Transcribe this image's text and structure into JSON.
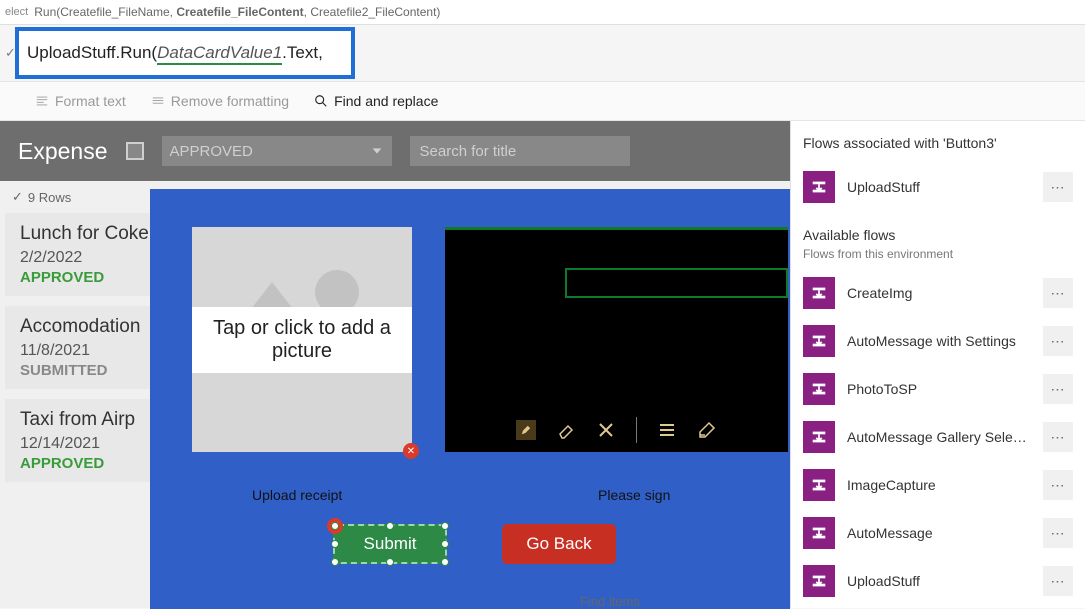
{
  "topHint": {
    "prefix": "Run(Createfile_FileName, ",
    "bold": "Createfile_FileContent",
    "rest": ", Createfile2_FileContent)"
  },
  "formula": {
    "part1": "UploadStuff.Run(",
    "ref": "DataCardValue1",
    "part2": ".Text,"
  },
  "toolbar": {
    "format": "Format text",
    "remove": "Remove formatting",
    "find": "Find and replace"
  },
  "expense": {
    "title": "Expense",
    "ddLabel": "APPROVED",
    "searchPlaceholder": "Search for title",
    "rowCount": "9 Rows"
  },
  "listItems": [
    {
      "title": "Lunch for Coke",
      "date": "2/2/2022",
      "status": "APPROVED",
      "statusClass": "approved"
    },
    {
      "title": "Accomodation",
      "date": "11/8/2021",
      "status": "SUBMITTED",
      "statusClass": "submitted"
    },
    {
      "title": "Taxi from Airp",
      "date": "12/14/2021",
      "status": "APPROVED",
      "statusClass": "approved"
    }
  ],
  "modal": {
    "imgText": "Tap or click to add a picture",
    "uploadLabel": "Upload receipt",
    "signLabel": "Please sign",
    "submit": "Submit",
    "goback": "Go Back",
    "findItems": "Find items"
  },
  "side": {
    "header": "Flows associated with 'Button3'",
    "assocFlows": [
      {
        "name": "UploadStuff"
      }
    ],
    "availHeader": "Available flows",
    "availSub": "Flows from this environment",
    "availFlows": [
      {
        "name": "CreateImg"
      },
      {
        "name": "AutoMessage with Settings"
      },
      {
        "name": "PhotoToSP"
      },
      {
        "name": "AutoMessage Gallery Select..."
      },
      {
        "name": "ImageCapture"
      },
      {
        "name": "AutoMessage"
      },
      {
        "name": "UploadStuff"
      }
    ]
  },
  "selectLabel": "elect"
}
